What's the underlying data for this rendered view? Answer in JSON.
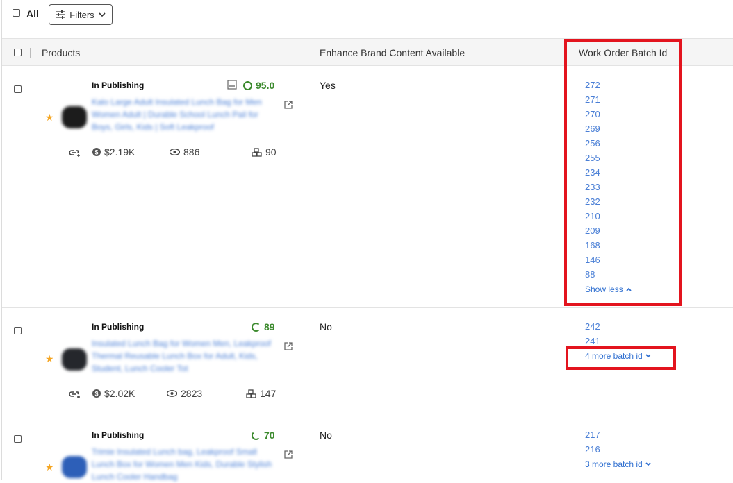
{
  "toolbar": {
    "all_label": "All",
    "filters_label": "Filters"
  },
  "table": {
    "columns": {
      "products": "Products",
      "ebc": "Enhance Brand Content Available",
      "batch": "Work Order Batch Id"
    },
    "rows": [
      {
        "status": "In Publishing",
        "title": "Kalo Large Adult Insulated Lunch Bag for Men Women Adult | Durable School Lunch Pail for Boys, Girls, Kids | Soft Leakproof",
        "score": "95.0",
        "revenue": "$2.19K",
        "views": "886",
        "units": "90",
        "ebc": "Yes",
        "batch_ids": [
          "272",
          "271",
          "270",
          "269",
          "256",
          "255",
          "234",
          "233",
          "232",
          "210",
          "209",
          "168",
          "146",
          "88"
        ],
        "toggle_label": "Show less"
      },
      {
        "status": "In Publishing",
        "title": "Insulated Lunch Bag for Women Men, Leakproof Thermal Reusable Lunch Box for Adult, Kids, Student, Lunch Cooler Tot",
        "score": "89",
        "revenue": "$2.02K",
        "views": "2823",
        "units": "147",
        "ebc": "No",
        "batch_ids": [
          "242",
          "241"
        ],
        "toggle_label": "4 more batch id"
      },
      {
        "status": "In Publishing",
        "title": "Trimie Insulated Lunch bag, Leakproof Small Lunch Box for Women Men Kids, Durable Stylish Lunch Cooler Handbag",
        "score": "70",
        "ebc": "No",
        "batch_ids": [
          "217",
          "216"
        ],
        "toggle_label": "3 more batch id"
      }
    ]
  },
  "colors": {
    "accent": "#4a7fd6",
    "score_green": "#3c8a2e",
    "highlight_red": "#e3141e",
    "star": "#f5a623"
  }
}
